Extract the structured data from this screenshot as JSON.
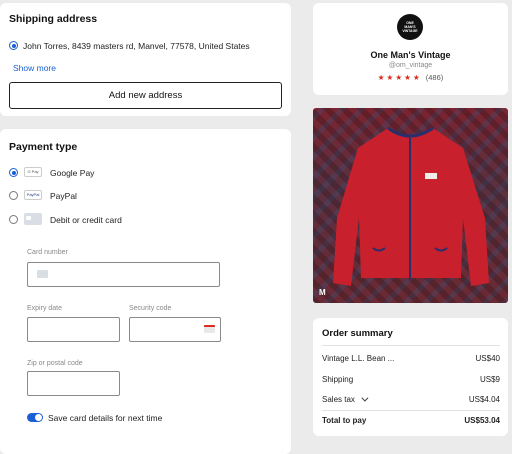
{
  "shipping": {
    "title": "Shipping address",
    "address": "John Torres, 8439 masters rd, Manvel, 77578, United States",
    "show_more": "Show more",
    "add_button": "Add new address"
  },
  "payment": {
    "title": "Payment type",
    "options": [
      {
        "label": "Google Pay",
        "icon": "G Pay",
        "selected": true
      },
      {
        "label": "PayPal",
        "icon": "PayPal",
        "selected": false
      },
      {
        "label": "Debit or credit card",
        "icon": "card",
        "selected": false
      }
    ],
    "card_number_label": "Card number",
    "expiry_label": "Expiry date",
    "security_label": "Security code",
    "zip_label": "Zip or postal code",
    "save_card_label": "Save card details for next time",
    "save_card_on": true
  },
  "seller": {
    "logo_text": "ONE MAN'S VINTAGE",
    "name": "One Man's Vintage",
    "handle": "@om_vintage",
    "stars": "★ ★ ★ ★ ★",
    "reviews": "(486)",
    "rating": 5
  },
  "product": {
    "badge": "M",
    "colors": {
      "jacket": "#c8202c",
      "rug": "#7a2430",
      "zip": "#2a2f6b"
    }
  },
  "summary": {
    "title": "Order summary",
    "items": [
      {
        "label": "Vintage L.L. Bean ...",
        "value": "US$40"
      },
      {
        "label": "Shipping",
        "value": "US$9"
      },
      {
        "label": "Sales tax",
        "value": "US$4.04"
      }
    ],
    "total_label": "Total to pay",
    "total_value": "US$53.04"
  },
  "colors": {
    "accent": "#1a5fd6",
    "star": "#e0281e"
  }
}
